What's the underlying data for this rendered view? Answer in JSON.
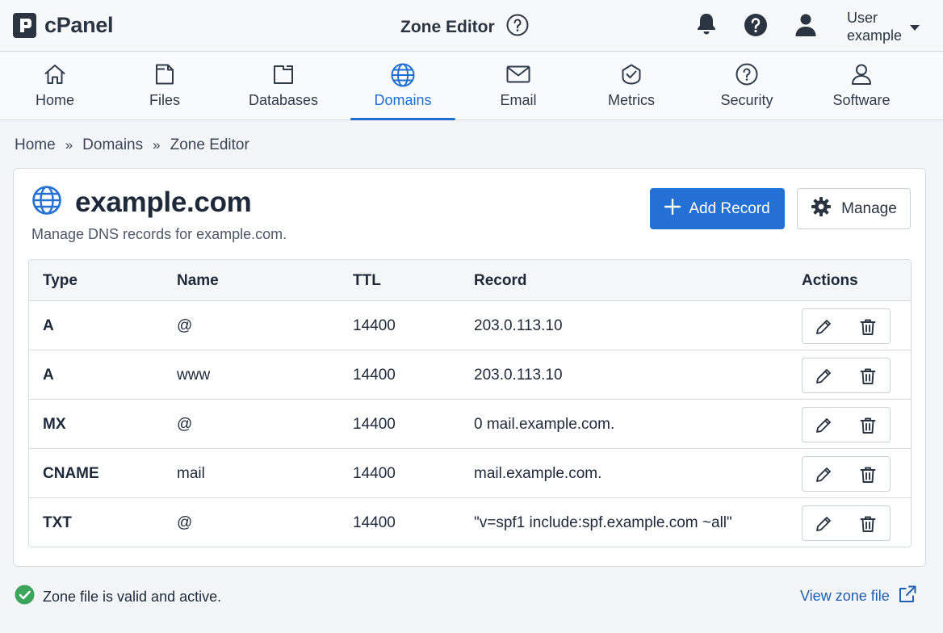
{
  "header": {
    "brand": "cPanel",
    "page_title": "Zone Editor",
    "user_line1": "User",
    "user_line2": "example"
  },
  "nav": {
    "items": [
      {
        "label": "Home",
        "icon": "home-icon"
      },
      {
        "label": "Files",
        "icon": "file-icon"
      },
      {
        "label": "Databases",
        "icon": "folder-icon"
      },
      {
        "label": "Domains",
        "icon": "globe-icon",
        "active": true
      },
      {
        "label": "Email",
        "icon": "mail-icon"
      },
      {
        "label": "Metrics",
        "icon": "metrics-icon"
      },
      {
        "label": "Security",
        "icon": "help-circle-icon"
      },
      {
        "label": "Software",
        "icon": "user-icon"
      }
    ]
  },
  "breadcrumb": {
    "items": [
      "Home",
      "Domains",
      "Zone Editor"
    ],
    "separator": "»"
  },
  "zone": {
    "domain": "example.com",
    "description": "Manage DNS records for example.com.",
    "add_label": "Add Record",
    "manage_label": "Manage"
  },
  "table": {
    "headers": [
      "Type",
      "Name",
      "TTL",
      "Record",
      "Actions"
    ],
    "rows": [
      {
        "type": "A",
        "name": "@",
        "ttl": "14400",
        "record": "203.0.113.10"
      },
      {
        "type": "A",
        "name": "www",
        "ttl": "14400",
        "record": "203.0.113.10"
      },
      {
        "type": "MX",
        "name": "@",
        "ttl": "14400",
        "record": "0 mail.example.com."
      },
      {
        "type": "CNAME",
        "name": "mail",
        "ttl": "14400",
        "record": "mail.example.com."
      },
      {
        "type": "TXT",
        "name": "@",
        "ttl": "14400",
        "record": "\"v=spf1 include:spf.example.com ~all\""
      }
    ]
  },
  "footer": {
    "status_text": "Zone file is valid and active.",
    "view_zone_label": "View zone file"
  },
  "colors": {
    "accent": "#2470d4",
    "active_nav": "#1f6fd1",
    "success": "#3aa55b",
    "link": "#1f5fae"
  }
}
